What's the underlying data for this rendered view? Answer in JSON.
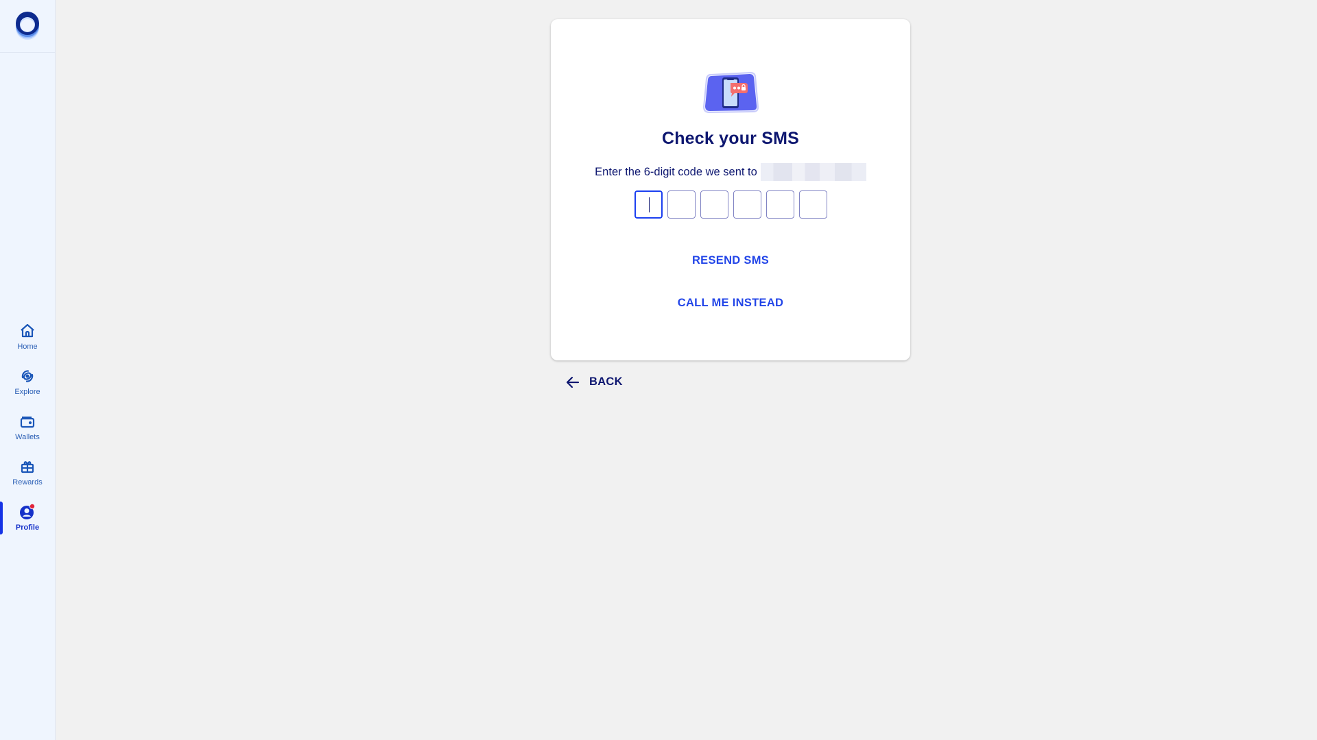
{
  "sidebar": {
    "logo": "app-logo",
    "items": [
      {
        "label": "Home",
        "icon": "home-icon",
        "active": false
      },
      {
        "label": "Explore",
        "icon": "explore-icon",
        "active": false
      },
      {
        "label": "Wallets",
        "icon": "wallet-icon",
        "active": false
      },
      {
        "label": "Rewards",
        "icon": "gift-icon",
        "active": false
      },
      {
        "label": "Profile",
        "icon": "profile-icon",
        "active": true,
        "notification_dot": true
      }
    ]
  },
  "verification": {
    "illustration": "phone-sms-icon",
    "title": "Check your SMS",
    "subtitle": "Enter the 6-digit code we sent to",
    "masked_phone": "",
    "code_length": 6,
    "code_values": [
      "",
      "",
      "",
      "",
      "",
      ""
    ],
    "resend_label": "RESEND SMS",
    "call_label": "CALL ME INSTEAD"
  },
  "back": {
    "label": "BACK",
    "icon": "arrow-left-icon"
  },
  "colors": {
    "primary": "#2245e8",
    "heading": "#0e1770",
    "sidebar_bg": "#eff5fe",
    "page_bg": "#f1f1f1",
    "notification": "#e0243a"
  }
}
